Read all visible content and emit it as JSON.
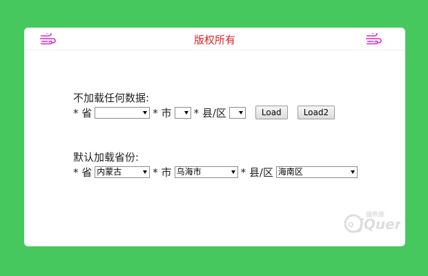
{
  "header": {
    "title": "版权所有",
    "left_icon": "wind-icon",
    "right_icon": "wind-icon",
    "title_color": "#e0202a",
    "icon_color": "#e020c8"
  },
  "section1": {
    "label": "不加载任何数据:",
    "province_label": "* 省",
    "province_value": "",
    "city_label": "* 市",
    "city_value": "",
    "county_label": "* 县/区",
    "county_value": "",
    "load_button": "Load",
    "load2_button": "Load2"
  },
  "section2": {
    "label": "默认加载省份:",
    "province_label": "* 省",
    "province_value": "内蒙古",
    "city_label": "* 市",
    "city_value": "乌海市",
    "county_label": "* 县/区",
    "county_value": "海南区"
  },
  "watermark": {
    "text": "jQuery",
    "sub_text": "插件库"
  },
  "colors": {
    "background": "#46c85e",
    "card": "#ffffff"
  }
}
